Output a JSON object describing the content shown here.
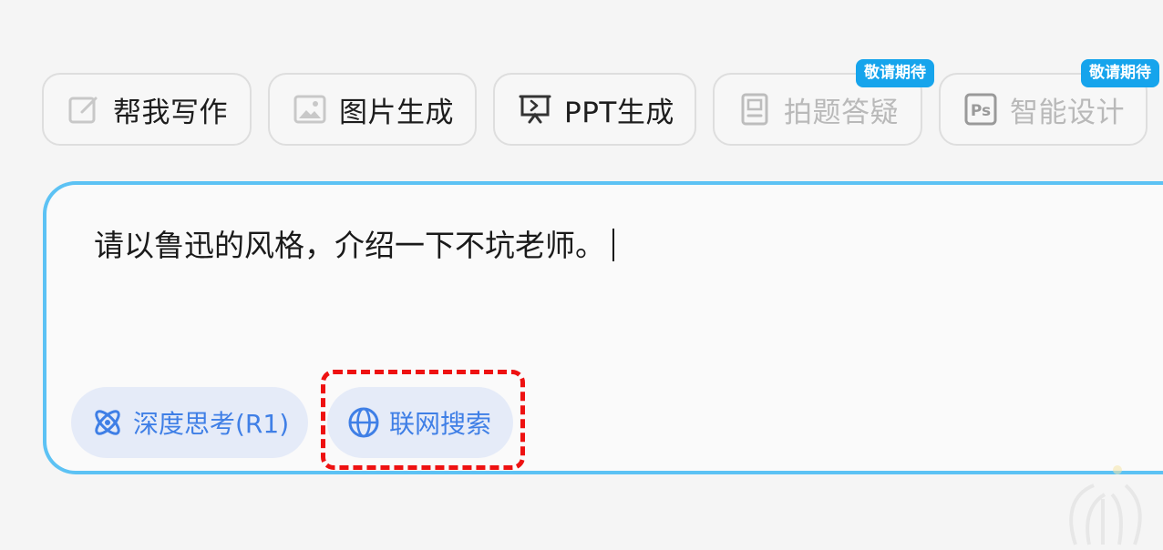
{
  "toolbar": {
    "chips": [
      {
        "label": "帮我写作",
        "icon": "edit-icon",
        "enabled": true
      },
      {
        "label": "图片生成",
        "icon": "image-icon",
        "enabled": true
      },
      {
        "label": "PPT生成",
        "icon": "presentation-icon",
        "enabled": true
      },
      {
        "label": "拍题答疑",
        "icon": "document-icon",
        "enabled": false,
        "badge": "敬请期待"
      },
      {
        "label": "智能设计",
        "icon": "ps-icon",
        "enabled": false,
        "badge": "敬请期待"
      }
    ]
  },
  "input": {
    "value": "请以鲁迅的风格，介绍一下不坑老师。"
  },
  "options": {
    "deep_think_label": "深度思考(R1)",
    "deep_think_icon": "atom-icon",
    "web_search_label": "联网搜索",
    "web_search_icon": "globe-icon"
  },
  "colors": {
    "accent": "#3f7fe6",
    "badge": "#16a4ec",
    "input_border": "#5cc2f4",
    "highlight": "#ee1111",
    "pill_bg": "#e5ebf8"
  }
}
